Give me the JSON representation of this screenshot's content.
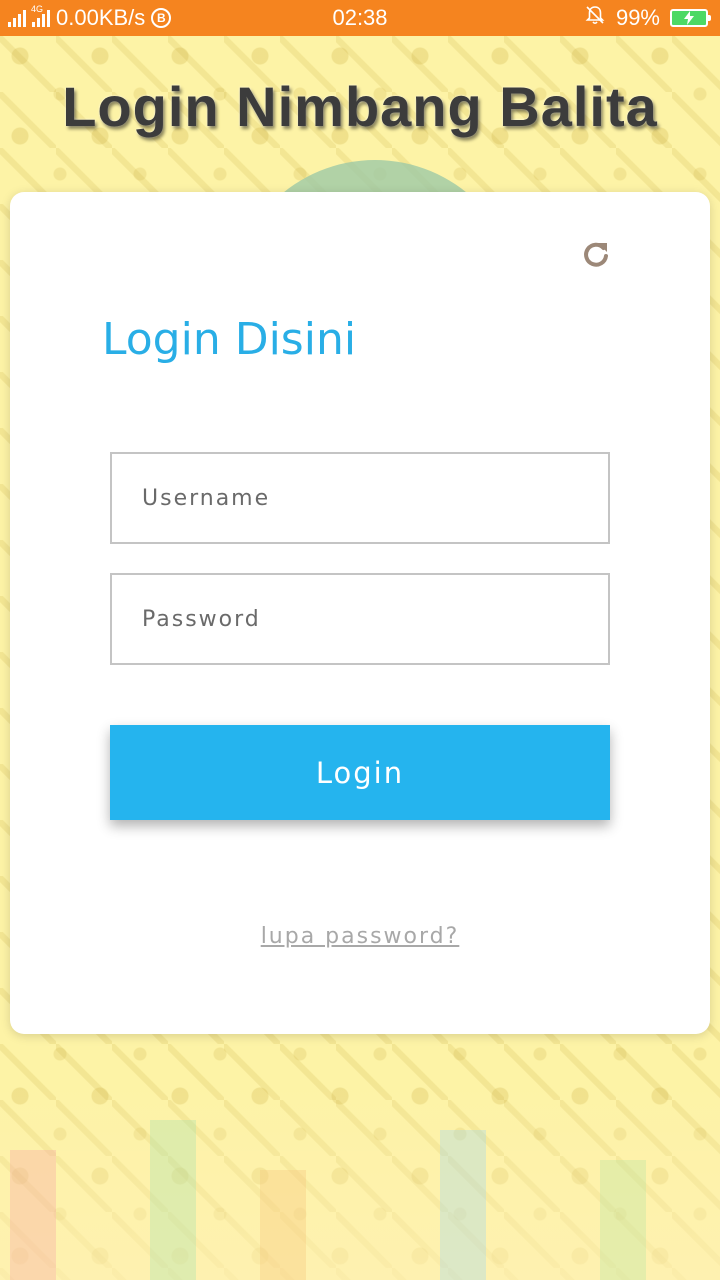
{
  "status_bar": {
    "network_type": "4G",
    "speed": "0.00KB/s",
    "b_badge": "B",
    "time": "02:38",
    "battery": "99%",
    "icons": [
      "signal-icon",
      "signal-4g-icon",
      "b-badge-icon",
      "mute-bell-icon",
      "battery-charging-icon"
    ]
  },
  "app": {
    "title": "Login Nimbang Balita"
  },
  "login_card": {
    "heading": "Login Disini",
    "username_placeholder": "Username",
    "password_placeholder": "Password",
    "login_label": "Login",
    "forgot_label": "lupa password?",
    "refresh_icon": "refresh-icon"
  },
  "colors": {
    "status_bar": "#f5841f",
    "accent": "#29aee6",
    "button": "#25b4ee",
    "background": "#fdf3a6"
  }
}
